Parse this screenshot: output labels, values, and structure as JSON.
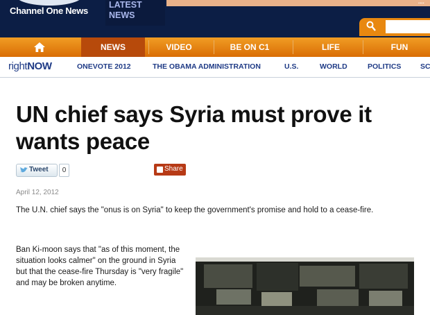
{
  "header": {
    "brand": "Channel One News",
    "latest_news": [
      "LATEST",
      "NEWS"
    ],
    "banner_text": "...."
  },
  "search": {
    "placeholder": ""
  },
  "main_nav": {
    "items": [
      {
        "label": "NEWS",
        "active": true
      },
      {
        "label": "VIDEO"
      },
      {
        "label": "BE ON C1"
      },
      {
        "label": "LIFE"
      },
      {
        "label": "FUN"
      }
    ]
  },
  "sub_nav": {
    "rightnow_prefix": "right",
    "rightnow_suffix": "NOW",
    "items": [
      {
        "label": "ONEVOTE 2012"
      },
      {
        "label": "THE OBAMA ADMINISTRATION"
      },
      {
        "label": "U.S."
      },
      {
        "label": "WORLD"
      },
      {
        "label": "POLITICS"
      },
      {
        "label": "SC"
      }
    ]
  },
  "article": {
    "headline": "UN chief says Syria must prove it wants peace",
    "tweet_label": "Tweet",
    "tweet_count": "0",
    "share_label": "Share",
    "date": "April 12, 2012",
    "lede": "The U.N. chief says the \"onus is on Syria\" to keep the government's promise and hold to a cease-fire.",
    "paragraph": "Ban Ki-moon says that \"as of this moment, the situation looks calmer\" on the ground in Syria but that the cease-fire Thursday is \"very fragile\" and may be broken anytime."
  },
  "colors": {
    "header_bg": "#0c1e45",
    "nav_orange": "#e88810",
    "nav_active": "#b74a0b",
    "subnav_text": "#1f3b86",
    "share_red": "#b73a16"
  }
}
